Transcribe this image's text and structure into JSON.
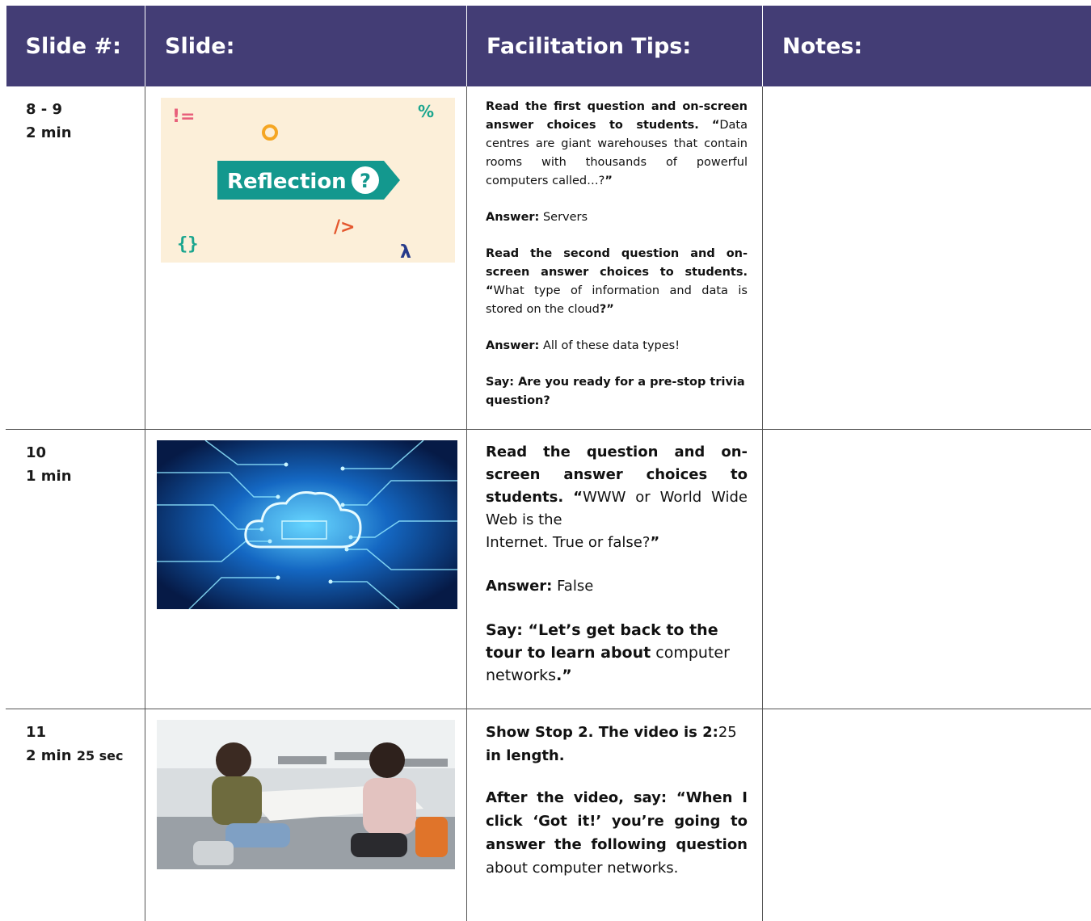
{
  "header": {
    "col1": "Slide #:",
    "col2": "Slide:",
    "col3": "Facilitation Tips:",
    "col4": "Notes:"
  },
  "rows": [
    {
      "slide_range": "8 - 9",
      "duration": "2 min",
      "image_text": "Reflection",
      "image_icon": "question-mark-icon",
      "tips": {
        "read1_bold": "Read the first question and on-screen answer choices to students.",
        "q1_open": "“",
        "q1_text": "Data centres are giant warehouses that contain rooms with thousands of powerful computers called…?",
        "q1_close": "”",
        "answer_label": "Answer:",
        "answer1": "Servers",
        "read2_bold": "Read the second question and on-screen answer choices to students.",
        "q2_open": "“",
        "q2_text": "What type of information and data is stored on the cloud",
        "q2_close": "?”",
        "answer2": "All of these data types!",
        "say": "Say: Are you ready for a pre-stop trivia question?"
      },
      "notes": ""
    },
    {
      "slide_range": "10",
      "duration": "1 min",
      "image_text": "",
      "tips": {
        "read_bold": "Read the question and on-screen answer choices to students.",
        "q_open": "“",
        "q_text_a": "WWW or World Wide Web is the",
        "q_text_b": "Internet. True or false?",
        "q_close": "”",
        "answer_label": "Answer:",
        "answer": "False",
        "say_bold": "Say: “Let’s get back to the tour to learn about",
        "say_rest": "computer networks",
        "say_end": ".”"
      },
      "notes": ""
    },
    {
      "slide_range": "11",
      "duration_main": "2 min",
      "duration_small": "25 sec",
      "tips": {
        "show_bold": "Show Stop 2. The video is 2:",
        "show_num": "25",
        "show_end": "in length.",
        "after_bold": "After the video, say: “When I click ‘Got it!’ you’re going to answer the following question",
        "after_rest": "about computer networks."
      },
      "notes": ""
    }
  ],
  "colors": {
    "header_bg": "#433d75",
    "header_text": "#ffffff",
    "reflection_bg": "#fcefd9",
    "reflection_teal": "#13988e"
  }
}
